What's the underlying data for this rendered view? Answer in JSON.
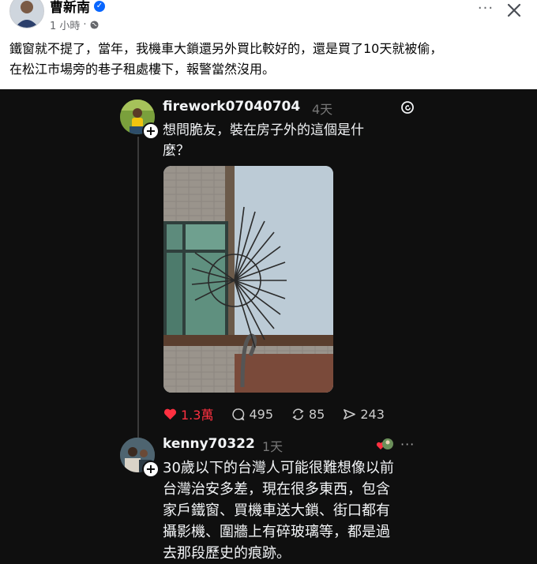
{
  "post": {
    "author": "曹新南",
    "time": "1 小時",
    "text_line1": "鐵窗就不提了，當年，我機車大鎖還另外買比較好的，還是買了10天就被偷，",
    "text_line2": "在松江市場旁的巷子租處樓下，報警當然沒用。",
    "more_label": "···"
  },
  "embedded": {
    "thread": {
      "username": "firework07040704",
      "time": "4天",
      "question_line1": "想問脆友，裝在房子外的這個是什",
      "question_line2": "麼？",
      "likes": "1.3萬",
      "comments": "495",
      "reposts": "85",
      "shares": "243"
    },
    "reply": {
      "username": "kenny70322",
      "time": "1天",
      "more_label": "···",
      "lines": [
        "30歲以下的台灣人可能很難想像以前",
        "台灣治安多差，現在很多東西，包含",
        "家戶鐵窗、買機車送大鎖、街口都有",
        "攝影機、圍牆上有碎玻璃等，都是過",
        "去那段歷史的痕跡。"
      ]
    }
  },
  "colors": {
    "accent": "#0866ff",
    "like": "#ff3040",
    "dark_bg": "#0f0f0f"
  }
}
